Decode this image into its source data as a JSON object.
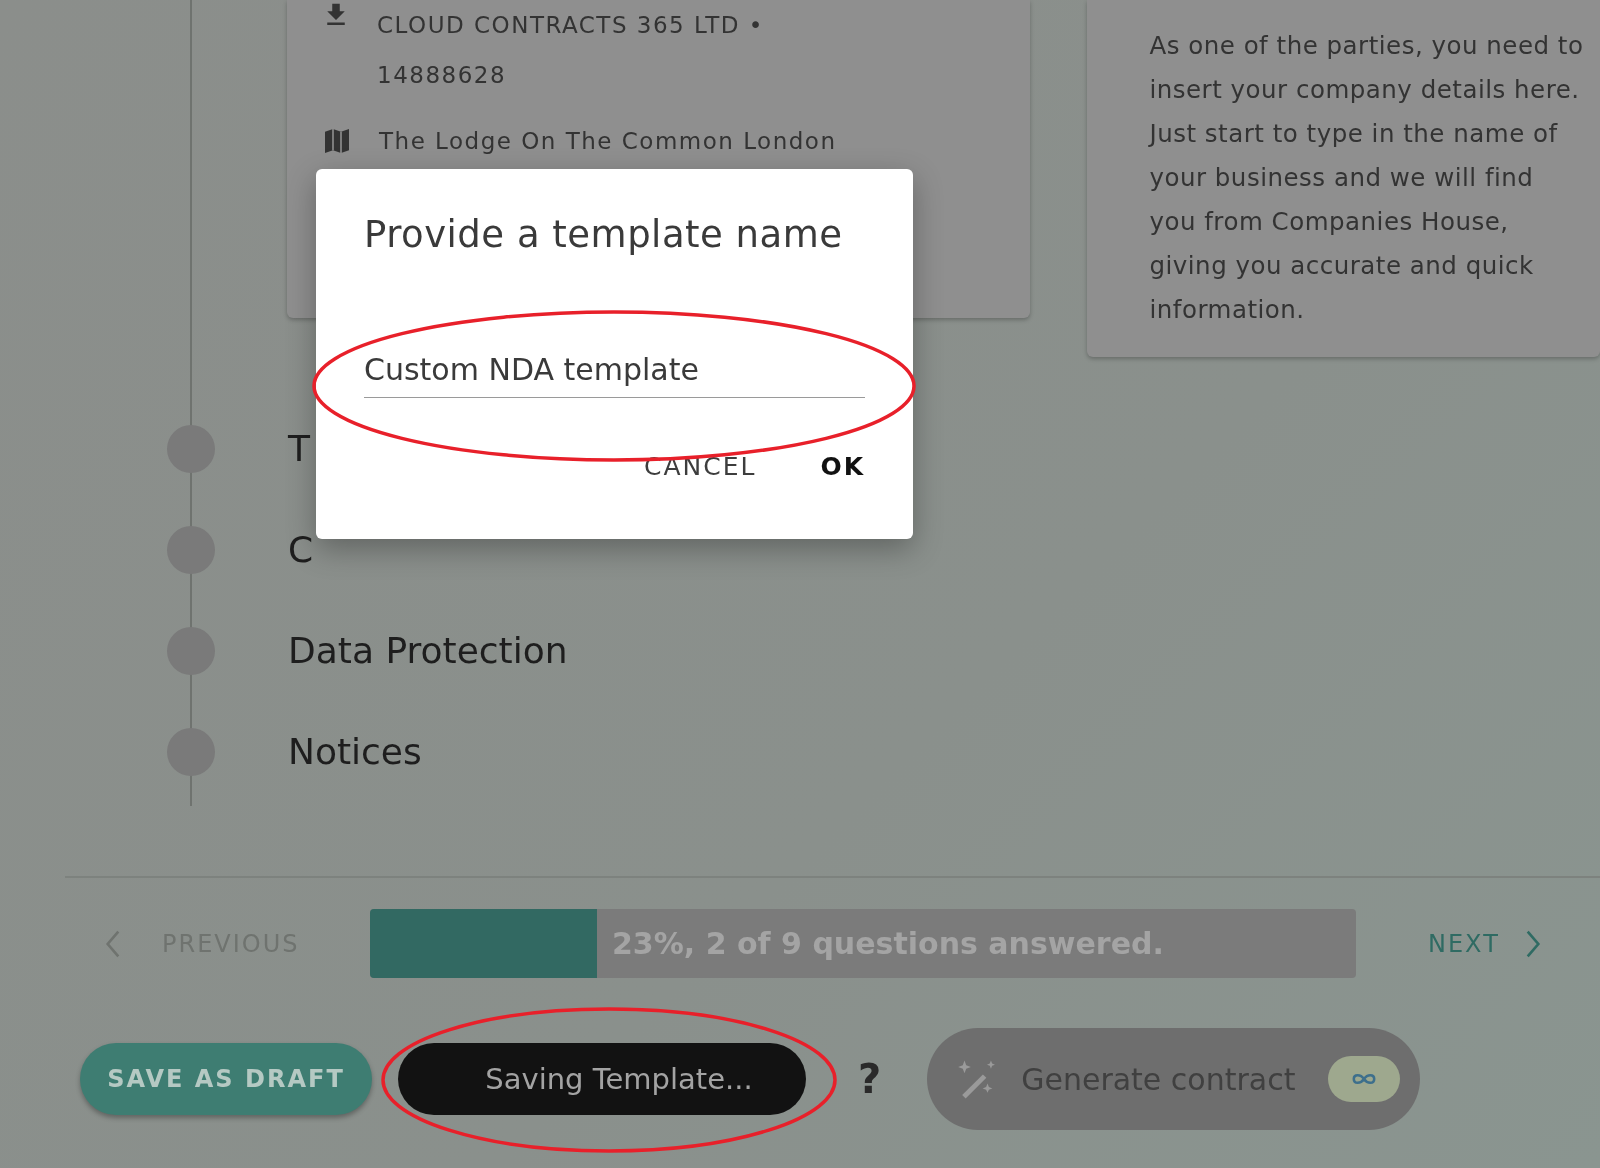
{
  "company_card": {
    "company": "CLOUD CONTRACTS 365 LTD • 14888628",
    "address": "The Lodge On The Common London"
  },
  "help_text": "As one of the parties, you need to insert your company details here. Just start to type in the name of your business and we will find you from Companies House, giving you accurate and quick information.",
  "steps": [
    {
      "label": "T"
    },
    {
      "label": "C"
    },
    {
      "label": "Data Protection"
    },
    {
      "label": "Notices"
    }
  ],
  "navigation": {
    "previous": "PREVIOUS",
    "next": "NEXT",
    "progress": {
      "level": 0.23,
      "text": "23%, 2 of 9 questions answered."
    }
  },
  "actions": {
    "save_draft": "SAVE AS DRAFT",
    "save_template": {
      "label": "Saving Template...",
      "highlighted": true
    },
    "help": "?",
    "generate": {
      "label": "Generate contract",
      "disabled": true
    }
  },
  "dialog": {
    "title": "Provide a template name",
    "value": "Custom NDA template",
    "highlighted": true,
    "buttons": [
      {
        "label": "CANCEL",
        "kind": "cancel"
      },
      {
        "label": "OK",
        "kind": "ok"
      }
    ]
  }
}
